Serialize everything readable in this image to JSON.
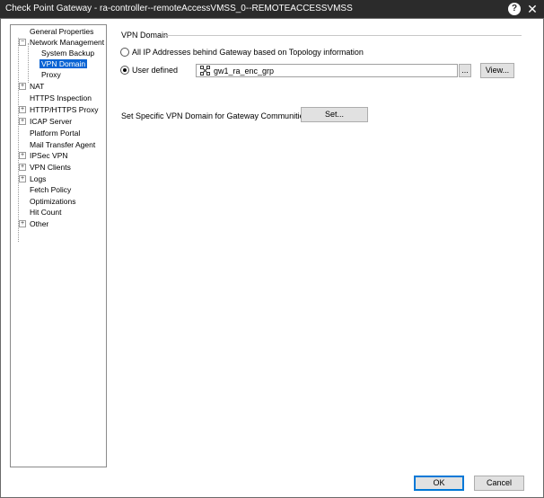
{
  "window": {
    "title": "Check Point Gateway - ra-controller--remoteAccessVMSS_0--REMOTEACCESSVMSS",
    "help_glyph": "?",
    "close_glyph": "✕"
  },
  "tree": {
    "items": [
      {
        "label": "General Properties"
      },
      {
        "label": "Network Management",
        "expander": "−"
      },
      {
        "label": "System Backup"
      },
      {
        "label": "VPN Domain",
        "selected": true
      },
      {
        "label": "Proxy"
      },
      {
        "label": "NAT",
        "expander": "+"
      },
      {
        "label": "HTTPS Inspection"
      },
      {
        "label": "HTTP/HTTPS Proxy",
        "expander": "+"
      },
      {
        "label": "ICAP Server",
        "expander": "+"
      },
      {
        "label": "Platform Portal"
      },
      {
        "label": "Mail Transfer Agent"
      },
      {
        "label": "IPSec VPN",
        "expander": "+"
      },
      {
        "label": "VPN Clients",
        "expander": "+"
      },
      {
        "label": "Logs",
        "expander": "+"
      },
      {
        "label": "Fetch Policy"
      },
      {
        "label": "Optimizations"
      },
      {
        "label": "Hit Count"
      },
      {
        "label": "Other",
        "expander": "+"
      }
    ]
  },
  "vpn_domain": {
    "section_title": "VPN Domain",
    "option_all": "All IP Addresses behind Gateway based on Topology information",
    "option_user_defined": "User defined",
    "selected_option": "user_defined",
    "group_icon": "network-group-icon",
    "group_value": "gw1_ra_enc_grp",
    "browse_label": "...",
    "view_label": "View..."
  },
  "communities": {
    "label": "Set Specific VPN Domain for Gateway Communities:",
    "set_label": "Set..."
  },
  "footer": {
    "ok_label": "OK",
    "cancel_label": "Cancel"
  },
  "colors": {
    "titlebar": "#2b2b2b",
    "selection": "#0a64d4",
    "default_button_border": "#0078d7"
  }
}
